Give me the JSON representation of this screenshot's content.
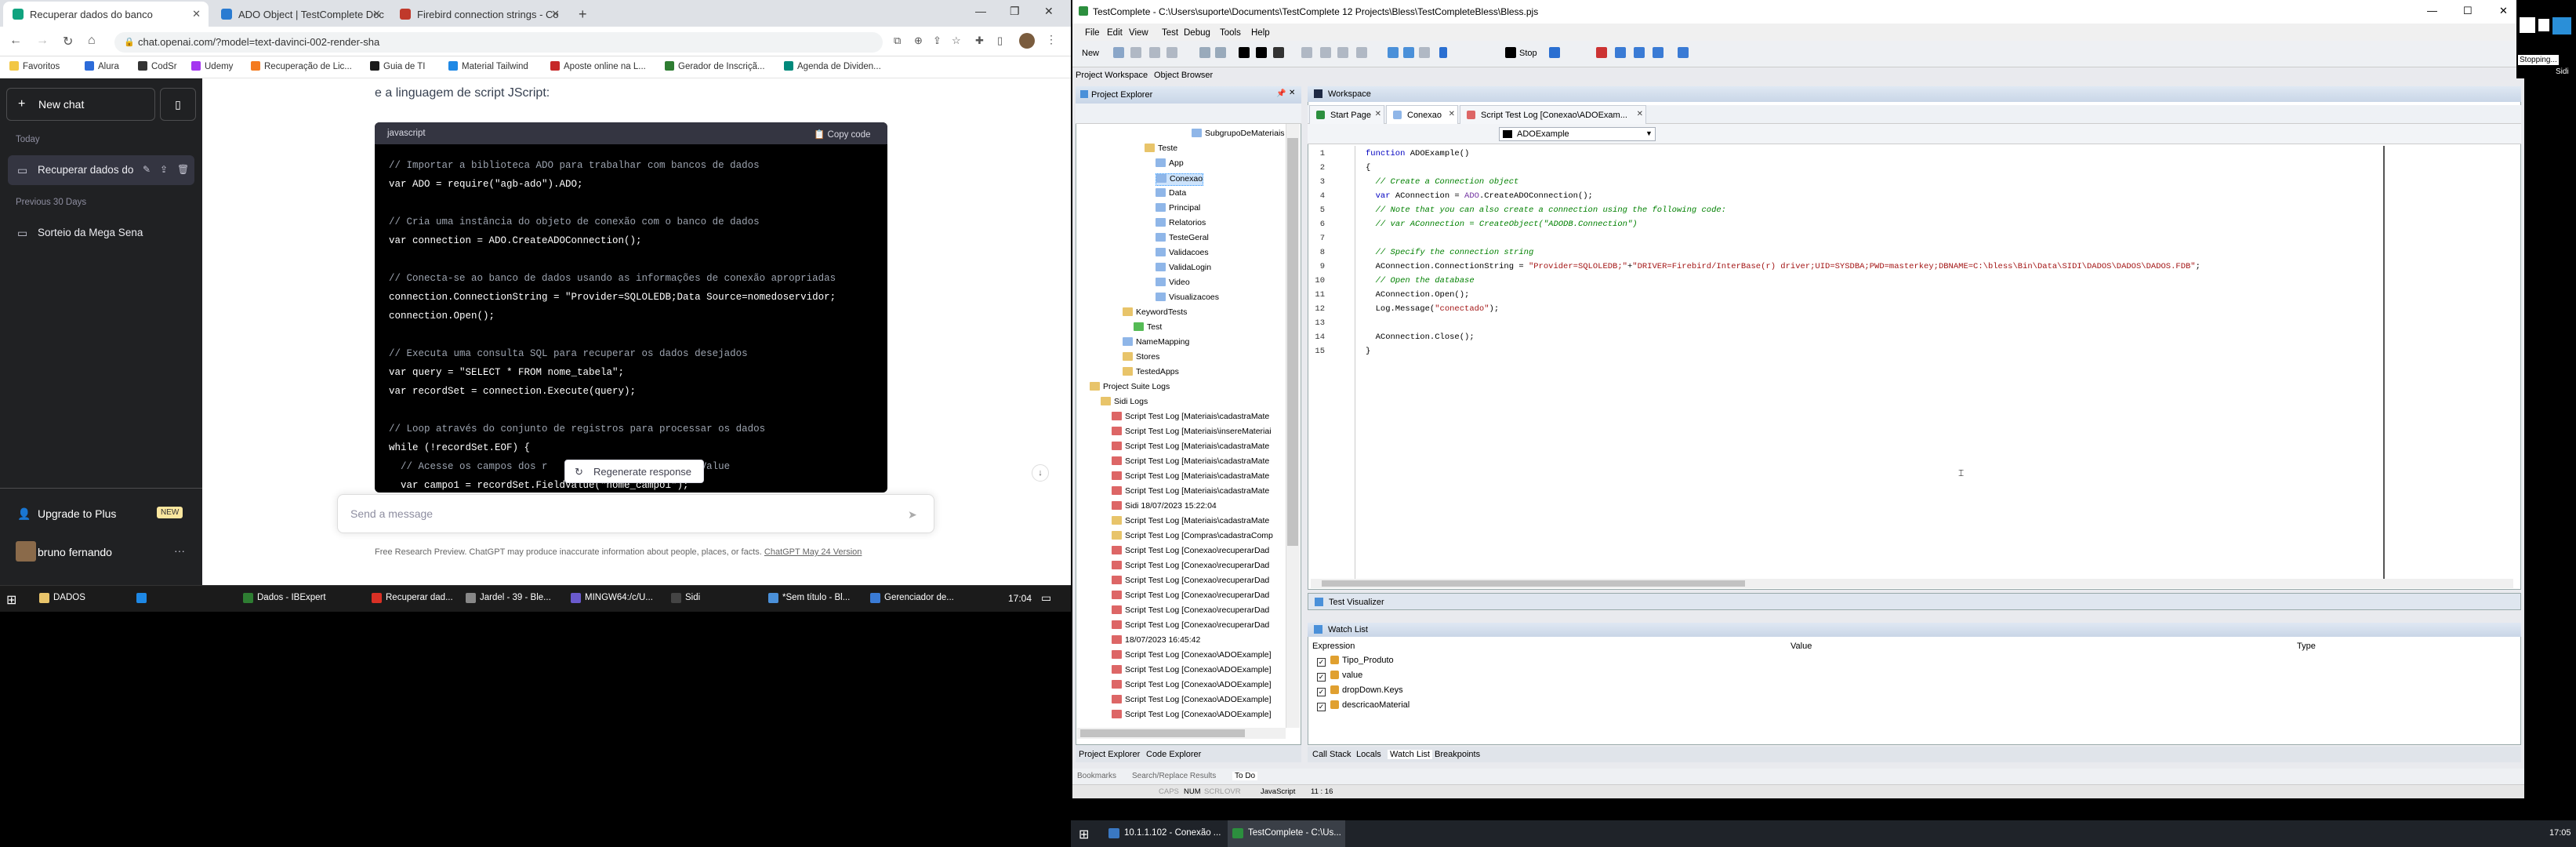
{
  "browser": {
    "tabs": [
      {
        "label": "Recuperar dados do banco",
        "close": "✕",
        "color": "#10a37f"
      },
      {
        "label": "ADO Object | TestComplete Doc",
        "close": "✕",
        "color": "#2a7bd1"
      },
      {
        "label": "Firebird connection strings - Co",
        "close": "✕",
        "color": "#c0392b"
      }
    ],
    "new_tab": "+",
    "url": "chat.openai.com/?model=text-davinci-002-render-sha",
    "bookmarks": [
      {
        "label": "Favoritos",
        "color": "#f2c744"
      },
      {
        "label": "Alura",
        "color": "#2c6bd9"
      },
      {
        "label": "CodSr",
        "color": "#333333"
      },
      {
        "label": "Udemy",
        "color": "#a435f0"
      },
      {
        "label": "Recuperação de Lic...",
        "color": "#f47b20"
      },
      {
        "label": "Guia de TI",
        "color": "#1a1a1a"
      },
      {
        "label": "Material Tailwind",
        "color": "#1e88e5"
      },
      {
        "label": "Aposte online na L...",
        "color": "#c62828"
      },
      {
        "label": "Gerador de Inscriçã...",
        "color": "#2e7d32"
      },
      {
        "label": "Agenda de Dividen...",
        "color": "#00897b"
      }
    ]
  },
  "chat": {
    "new_chat": "New chat",
    "sections": {
      "today": "Today",
      "previous": "Previous 30 Days"
    },
    "history": [
      "Recuperar dados do",
      "Sorteio da Mega Sena"
    ],
    "upgrade": "Upgrade to Plus",
    "new_badge": "NEW",
    "user": "bruno fernando",
    "intro": "e a linguagem de script JScript:",
    "code_lang": "javascript",
    "copy_code": "Copy code",
    "code_lines": [
      {
        "text": "// Importar a biblioteca ADO para trabalhar com bancos de dados",
        "cls": "cm"
      },
      {
        "text": "var ADO = require(\"agb-ado\").ADO;",
        "cls": ""
      },
      {
        "text": "// Cria uma instância do objeto de conexão com o banco de dados",
        "cls": "cm"
      },
      {
        "text": "var connection = ADO.CreateADOConnection();",
        "cls": ""
      },
      {
        "text": "// Conecta-se ao banco de dados usando as informações de conexão apropriadas",
        "cls": "cm"
      },
      {
        "text": "connection.ConnectionString = \"Provider=SQLOLEDB;Data Source=nomedoservidor;",
        "cls": ""
      },
      {
        "text": "connection.Open();",
        "cls": ""
      },
      {
        "text": "// Executa uma consulta SQL para recuperar os dados desejados",
        "cls": "cm"
      },
      {
        "text": "var query = \"SELECT * FROM nome_tabela\";",
        "cls": ""
      },
      {
        "text": "var recordSet = connection.Execute(query);",
        "cls": ""
      },
      {
        "text": "// Loop através do conjunto de registros para processar os dados",
        "cls": "cm"
      },
      {
        "text": "while (!recordSet.EOF) {",
        "cls": ""
      },
      {
        "text": "  // Acesse os campos dos r                  do FieldValue",
        "cls": "cm"
      },
      {
        "text": "  var campo1 = recordSet.FieldValue(\"nome_campo1\");",
        "cls": ""
      }
    ],
    "regenerate": "Regenerate response",
    "send_placeholder": "Send a message",
    "footer": "Free Research Preview. ChatGPT may produce inaccurate information about people, places, or facts.",
    "footer_link": "ChatGPT May 24 Version"
  },
  "left_taskbar": {
    "items": [
      {
        "label": "DADOS",
        "color": "#e8c46a"
      },
      {
        "label": "Dados - IBExpert",
        "color": "#2e7d32"
      },
      {
        "label": "Recuperar dad...",
        "color": "#d93025"
      },
      {
        "label": "Jardel - 39 - Ble...",
        "color": "#888888"
      },
      {
        "label": "MINGW64:/c/U...",
        "color": "#6a5acd"
      },
      {
        "label": "Sidi",
        "color": "#444444"
      },
      {
        "label": "*Sem título - Bl...",
        "color": "#4a90d9"
      },
      {
        "label": "Gerenciador de...",
        "color": "#3a7bd5"
      }
    ],
    "clock": "17:04"
  },
  "tc": {
    "title": "TestComplete - C:\\Users\\suporte\\Documents\\TestComplete 12 Projects\\Bless\\TestCompleteBless\\Bless.pjs",
    "menu": [
      "File",
      "Edit",
      "View",
      "Test",
      "Debug",
      "Tools",
      "Help"
    ],
    "new_label": "New",
    "stop_label": "Stop",
    "tabs": [
      "Project Workspace",
      "Object Browser"
    ],
    "project_explorer": "Project Explorer",
    "tree": [
      {
        "label": "SubgrupoDeMateriais",
        "ind": 140,
        "k": "doc"
      },
      {
        "label": "Teste",
        "ind": 80,
        "k": "fold"
      },
      {
        "label": "App",
        "ind": 94,
        "k": "doc"
      },
      {
        "label": "Conexao",
        "ind": 94,
        "k": "doc",
        "sel": true
      },
      {
        "label": "Data",
        "ind": 94,
        "k": "doc"
      },
      {
        "label": "Principal",
        "ind": 94,
        "k": "doc"
      },
      {
        "label": "Relatorios",
        "ind": 94,
        "k": "doc"
      },
      {
        "label": "TesteGeral",
        "ind": 94,
        "k": "doc"
      },
      {
        "label": "Validacoes",
        "ind": 94,
        "k": "doc"
      },
      {
        "label": "ValidaLogin",
        "ind": 94,
        "k": "doc"
      },
      {
        "label": "Video",
        "ind": 94,
        "k": "doc"
      },
      {
        "label": "Visualizacoes",
        "ind": 94,
        "k": "doc"
      },
      {
        "label": "KeywordTests",
        "ind": 52,
        "k": "fold"
      },
      {
        "label": "Test",
        "ind": 66,
        "k": "gr"
      },
      {
        "label": "NameMapping",
        "ind": 52,
        "k": "doc"
      },
      {
        "label": "Stores",
        "ind": 52,
        "k": "fold"
      },
      {
        "label": "TestedApps",
        "ind": 52,
        "k": "fold"
      },
      {
        "label": "Project Suite Logs",
        "ind": 10,
        "k": "fold"
      },
      {
        "label": "Sidi Logs",
        "ind": 24,
        "k": "fold"
      },
      {
        "label": "Script Test Log [Materiais\\cadastraMate",
        "ind": 38,
        "k": "lg"
      },
      {
        "label": "Script Test Log [Materiais\\insereMateriai",
        "ind": 38,
        "k": "lg"
      },
      {
        "label": "Script Test Log [Materiais\\cadastraMate",
        "ind": 38,
        "k": "lg"
      },
      {
        "label": "Script Test Log [Materiais\\cadastraMate",
        "ind": 38,
        "k": "lg"
      },
      {
        "label": "Script Test Log [Materiais\\cadastraMate",
        "ind": 38,
        "k": "lg"
      },
      {
        "label": "Script Test Log [Materiais\\cadastraMate",
        "ind": 38,
        "k": "lg"
      },
      {
        "label": "Sidi 18/07/2023 15:22:04",
        "ind": 38,
        "k": "lg"
      },
      {
        "label": "Script Test Log [Materiais\\cadastraMate",
        "ind": 38,
        "k": "fold"
      },
      {
        "label": "Script Test Log [Compras\\cadastraComp",
        "ind": 38,
        "k": "fold"
      },
      {
        "label": "Script Test Log [Conexao\\recuperarDad",
        "ind": 38,
        "k": "lg"
      },
      {
        "label": "Script Test Log [Conexao\\recuperarDad",
        "ind": 38,
        "k": "lg"
      },
      {
        "label": "Script Test Log [Conexao\\recuperarDad",
        "ind": 38,
        "k": "lg"
      },
      {
        "label": "Script Test Log [Conexao\\recuperarDad",
        "ind": 38,
        "k": "lg"
      },
      {
        "label": "Script Test Log [Conexao\\recuperarDad",
        "ind": 38,
        "k": "lg"
      },
      {
        "label": "Script Test Log [Conexao\\recuperarDad",
        "ind": 38,
        "k": "lg"
      },
      {
        "label": "18/07/2023 16:45:42",
        "ind": 38,
        "k": "lg"
      },
      {
        "label": "Script Test Log [Conexao\\ADOExample]",
        "ind": 38,
        "k": "lg"
      },
      {
        "label": "Script Test Log [Conexao\\ADOExample]",
        "ind": 38,
        "k": "lg"
      },
      {
        "label": "Script Test Log [Conexao\\ADOExample]",
        "ind": 38,
        "k": "lg"
      },
      {
        "label": "Script Test Log [Conexao\\ADOExample]",
        "ind": 38,
        "k": "lg"
      },
      {
        "label": "Script Test Log [Conexao\\ADOExample]",
        "ind": 38,
        "k": "lg"
      }
    ],
    "pe_tabs": [
      "Project Explorer",
      "Code Explorer"
    ],
    "workspace": "Workspace",
    "ws_tabs": [
      "Start Page",
      "Conexao",
      "Script Test Log [Conexao\\ADOExam..."
    ],
    "routine": "ADOExample",
    "code": [
      {
        "n": "1",
        "h": "<span class='b'>function</span> ADOExample()"
      },
      {
        "n": "2",
        "h": "{"
      },
      {
        "n": "3",
        "h": "  <span class='g'>// Create a Connection object</span>"
      },
      {
        "n": "4",
        "h": "  <span class='b'>var</span> AConnection = <span class='p'>ADO</span>.CreateADOConnection();"
      },
      {
        "n": "5",
        "h": "  <span class='g'>// Note that you can also create a connection using the following code:</span>"
      },
      {
        "n": "6",
        "h": "  <span class='g'>// var AConnection = CreateObject(\"ADODB.Connection\")</span>"
      },
      {
        "n": "7",
        "h": ""
      },
      {
        "n": "8",
        "h": "  <span class='g'>// Specify the connection string</span>"
      },
      {
        "n": "9",
        "h": "  AConnection.ConnectionString = <span class='s'>\"Provider=SQLOLEDB;\"</span>+<span class='s'>\"DRIVER=Firebird/InterBase(r) driver;UID=SYSDBA;PWD=masterkey;DBNAME=C:\\bless\\Bin\\Data\\SIDI\\DADOS\\DADOS\\DADOS.FDB\"</span>;"
      },
      {
        "n": "10",
        "h": "  <span class='g'>// Open the database</span>"
      },
      {
        "n": "11",
        "h": "  AConnection.Open();"
      },
      {
        "n": "12",
        "h": "  Log.Message(<span class='s'>\"conectado\"</span>);"
      },
      {
        "n": "13",
        "h": ""
      },
      {
        "n": "14",
        "h": "  AConnection.Close();"
      },
      {
        "n": "15",
        "h": "}"
      }
    ],
    "test_visualizer": "Test Visualizer",
    "watch_list": "Watch List",
    "watch_cols": [
      "Expression",
      "Value",
      "Type"
    ],
    "watch_items": [
      "Tipo_Produto",
      "value",
      "dropDown.Keys",
      "descricaoMaterial"
    ],
    "bottom_tabs": [
      "Call Stack",
      "Locals",
      "Watch List",
      "Breakpoints"
    ],
    "panel_tabs": [
      "Bookmarks",
      "Search/Replace Results",
      "To Do"
    ],
    "status": [
      "CAPS",
      "NUM",
      "SCRL",
      "OVR",
      "JavaScript",
      "11 : 16"
    ],
    "stopping": "Stopping...",
    "sidi": "Sidi"
  },
  "right_taskbar": {
    "items": [
      {
        "label": "10.1.1.102 - Conexão ...",
        "color": "#3a78c2"
      },
      {
        "label": "TestComplete - C:\\Us...",
        "color": "#2c8f3e"
      }
    ],
    "clock": "17:05"
  }
}
